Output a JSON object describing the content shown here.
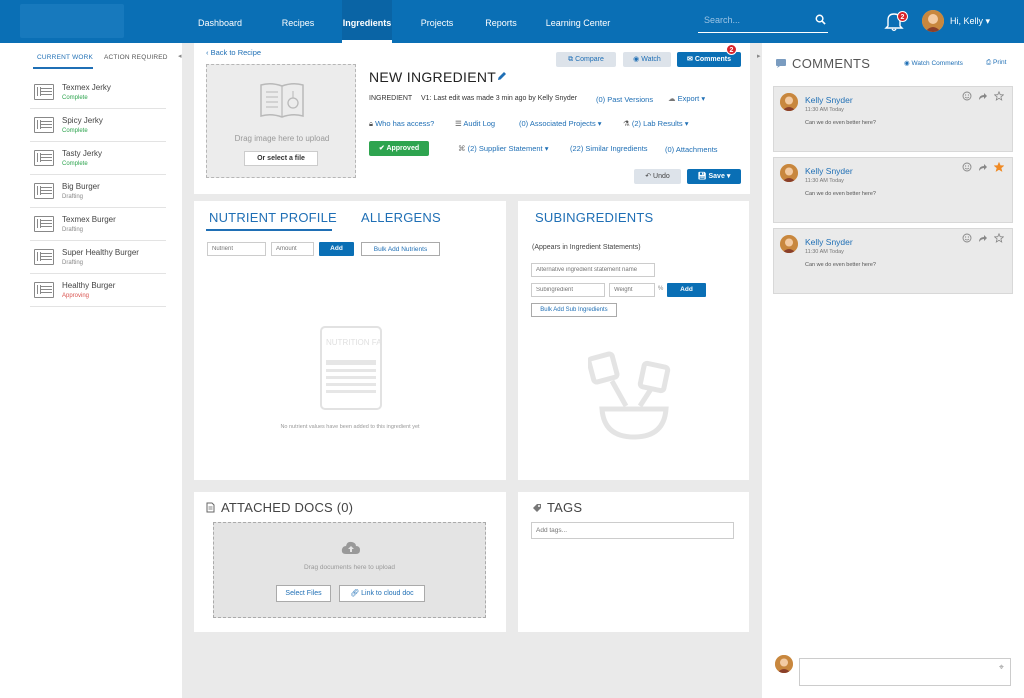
{
  "nav": {
    "items": [
      "Dashboard",
      "Recipes",
      "Ingredients",
      "Projects",
      "Reports",
      "Learning Center"
    ],
    "active": "Ingredients",
    "search_placeholder": "Search...",
    "notification_count": "2",
    "greeting": "Hi, Kelly"
  },
  "left": {
    "tabs": [
      "CURRENT WORK",
      "ACTION REQUIRED"
    ],
    "items": [
      {
        "name": "Texmex Jerky",
        "status": "Complete",
        "color": "#2ea44f"
      },
      {
        "name": "Spicy Jerky",
        "status": "Complete",
        "color": "#2ea44f"
      },
      {
        "name": "Tasty Jerky",
        "status": "Complete",
        "color": "#2ea44f"
      },
      {
        "name": "Big Burger",
        "status": "Drafting",
        "color": "#888888"
      },
      {
        "name": "Texmex Burger",
        "status": "Drafting",
        "color": "#888888"
      },
      {
        "name": "Super Healthy Burger",
        "status": "Drafting",
        "color": "#888888"
      },
      {
        "name": "Healthy Burger",
        "status": "Approving",
        "color": "#d9534f"
      }
    ]
  },
  "header": {
    "back": "Back to Recipe",
    "dropzone_text": "Drag image here to upload",
    "dropzone_button": "Or select a file",
    "title": "NEW INGREDIENT",
    "type": "INGREDIENT",
    "version": "V1: Last edit was made 3 min ago by Kelly Snyder",
    "past_versions": "(0) Past Versions",
    "export": "Export",
    "who_access": "Who has access?",
    "audit_log": "Audit Log",
    "associated_projects": "(0) Associated Projects",
    "lab_results": "(2) Lab Results",
    "status": "Approved",
    "supplier_statement": "(2) Supplier Statement",
    "similar": "(22) Similar Ingredients",
    "attachments": "(0) Attachments",
    "compare": "Compare",
    "watch": "Watch",
    "comments": "Comments",
    "comments_badge": "2",
    "undo": "Undo",
    "save": "Save"
  },
  "nutrient": {
    "tab1": "NUTRIENT PROFILE",
    "tab2": "ALLERGENS",
    "nutrient_placeholder": "Nutrient",
    "amount_placeholder": "Amount",
    "add": "Add",
    "bulk": "Bulk Add Nutrients",
    "empty_icon_label": "NUTRITION FACTS",
    "empty": "No nutrient values have been added to this ingredient yet"
  },
  "sub": {
    "title": "SUBINGREDIENTS",
    "note": "(Appears in Ingredient Statements)",
    "alt_placeholder": "Alternative ingredient statement name",
    "sub_placeholder": "Subingredient",
    "weight_placeholder": "Weight",
    "unit": "%",
    "add": "Add",
    "bulk": "Bulk Add Sub Ingredients"
  },
  "docs": {
    "title": "ATTACHED DOCS (0)",
    "drop": "Drag documents here to upload",
    "select": "Select Files",
    "link": "Link to cloud doc"
  },
  "tags": {
    "title": "TAGS",
    "placeholder": "Add tags..."
  },
  "comments": {
    "title": "COMMENTS",
    "watch": "Watch Comments",
    "print": "Print",
    "items": [
      {
        "name": "Kelly Snyder",
        "time": "11:30 AM Today",
        "text": "Can we do even better here?",
        "starred": false
      },
      {
        "name": "Kelly Snyder",
        "time": "11:30 AM Today",
        "text": "Can we do even better here?",
        "starred": true
      },
      {
        "name": "Kelly Snyder",
        "time": "11:30 AM Today",
        "text": "Can we do even better here?",
        "starred": false
      }
    ]
  }
}
